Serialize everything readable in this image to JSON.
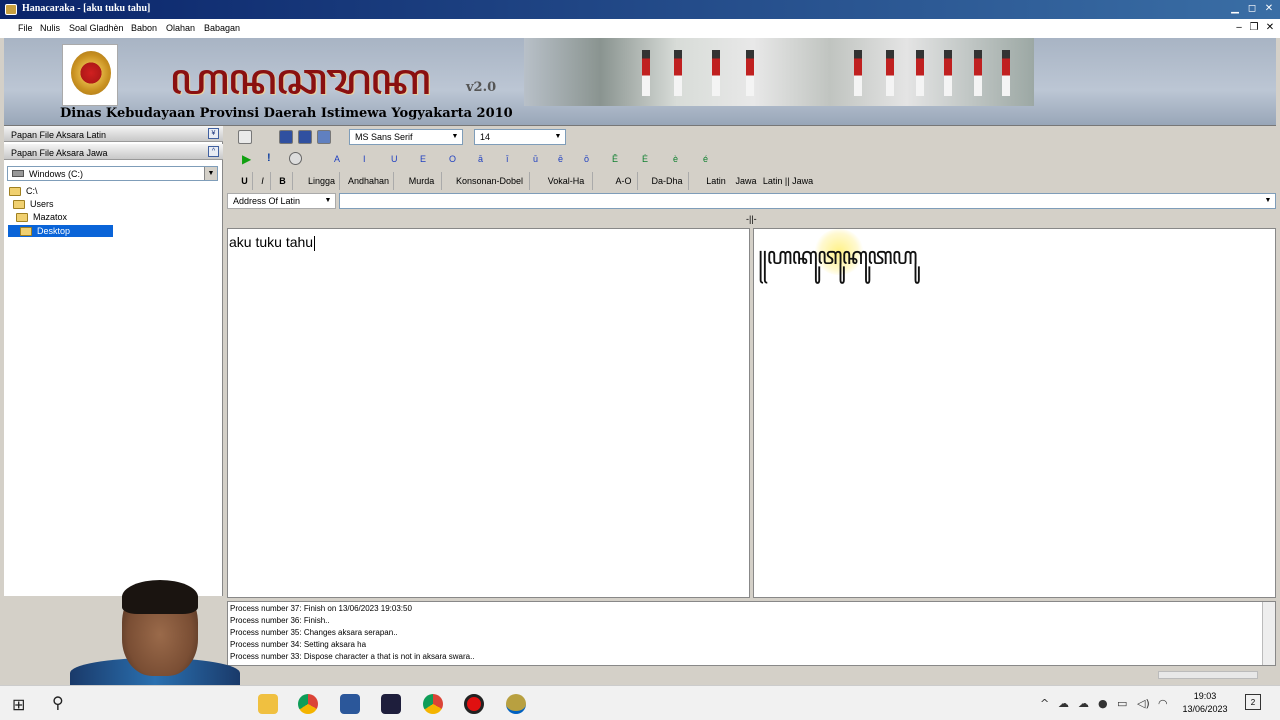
{
  "window": {
    "title": "Hanacaraka - [aku tuku tahu]",
    "min": "▁",
    "max": "◻",
    "close": "✕"
  },
  "mdi": {
    "min": "‒",
    "restore": "❐",
    "close": "✕"
  },
  "menu": [
    "File",
    "Nulis",
    "Soal Gladhèn",
    "Babon",
    "Olahan",
    "Babagan"
  ],
  "banner": {
    "brand": "ꦲꦤꦕꦫꦏ",
    "version": "v2.0",
    "subtitle": "Dinas Kebudayaan Provinsi Daerah Istimewa Yogyakarta 2010"
  },
  "leftpanel": {
    "panel1": "Papan File Aksara Latin",
    "panel2": "Papan File Aksara Jawa",
    "chev1": "¥",
    "chev2": "^",
    "drive": "Windows (C:)",
    "tree": [
      "C:\\",
      "Users",
      "Mazatox",
      "Desktop"
    ]
  },
  "toolbar": {
    "font": "MS Sans Serif",
    "size": "14",
    "vowels": [
      "A",
      "I",
      "U",
      "E",
      "O",
      "ā",
      "ī",
      "ū",
      "ē",
      "ō",
      "Ê",
      "Ė",
      "è",
      "é"
    ],
    "format": [
      "U",
      "I",
      "B"
    ],
    "buttons": [
      "Lingga",
      "Andhahan",
      "Murda",
      "Konsonan-Dobel",
      "Vokal-Ha",
      "A-O",
      "Da-Dha",
      "Latin",
      "Jawa",
      "Latin || Jawa"
    ]
  },
  "address": {
    "label": "Address Of Latin",
    "value": ""
  },
  "editor": {
    "split_mark": "-||-",
    "latin_text": "aku tuku tahu",
    "jawa_text": "꧋ꦲꦏꦸꦠꦸꦏꦸꦠꦲꦸ"
  },
  "log": [
    "Process number 37: Finish on 13/06/2023 19:03:50",
    "Process number 36: Finish..",
    "Process number 35: Changes aksara serapan..",
    "Process number 34: Setting aksara ha",
    "Process number 33: Dispose character a that is not in aksara swara.."
  ],
  "taskbar": {
    "clock_time": "19:03",
    "clock_date": "13/06/2023",
    "notif": "2"
  }
}
